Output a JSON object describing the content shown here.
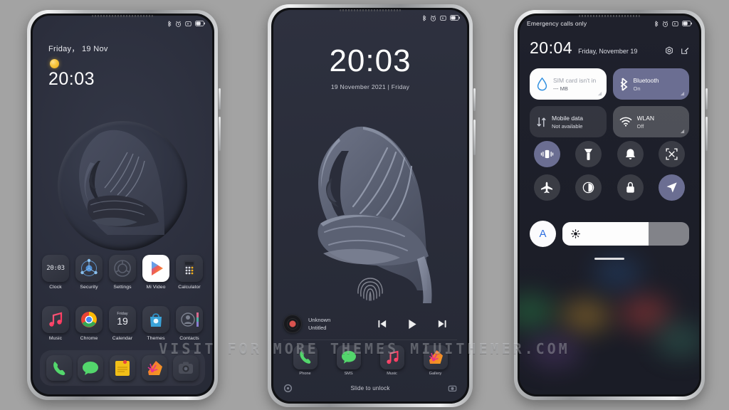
{
  "background_color": "#a3a3a3",
  "watermark": "VISIT FOR MORE THEMES MIUITHEMER.COM",
  "phone1": {
    "name": "home-screen",
    "statusbar": {
      "left_text": "",
      "icons": [
        "bluetooth-icon",
        "alarm-icon",
        "dnd-icon",
        "battery-icon"
      ]
    },
    "widget": {
      "date": "Friday， 19 Nov",
      "weather_icon": "sun-icon",
      "time": "20:03"
    },
    "wallpaper": "hijab-silhouette-emboss-circle",
    "apps_row1": [
      {
        "label": "Clock",
        "icon": "clock-icon",
        "display": "20:03"
      },
      {
        "label": "Security",
        "icon": "security-icon"
      },
      {
        "label": "Settings",
        "icon": "settings-icon"
      },
      {
        "label": "Mi Video",
        "icon": "mi-video-icon"
      },
      {
        "label": "Calculator",
        "icon": "calculator-icon"
      }
    ],
    "apps_row2": [
      {
        "label": "Music",
        "icon": "music-icon"
      },
      {
        "label": "Chrome",
        "icon": "chrome-icon"
      },
      {
        "label": "Calendar",
        "icon": "calendar-icon",
        "day_name": "Friday",
        "day_num": "19"
      },
      {
        "label": "Themes",
        "icon": "themes-icon"
      },
      {
        "label": "Contacts",
        "icon": "contacts-icon"
      }
    ],
    "dock": [
      {
        "label": "Phone",
        "icon": "phone-icon"
      },
      {
        "label": "Messages",
        "icon": "sms-icon"
      },
      {
        "label": "Notes",
        "icon": "notes-icon"
      },
      {
        "label": "Gallery",
        "icon": "gallery-icon"
      },
      {
        "label": "Camera",
        "icon": "camera-icon"
      }
    ]
  },
  "phone2": {
    "name": "lock-screen",
    "statusbar": {
      "left_text": "",
      "icons": [
        "bluetooth-icon",
        "alarm-icon",
        "dnd-icon",
        "battery-icon"
      ]
    },
    "time": "20:03",
    "date": "19 November 2021 | Friday",
    "wallpaper": "hijab-silhouette-emboss",
    "fingerprint_icon": "fingerprint-icon",
    "player": {
      "album_icon": "vinyl-record-icon",
      "title": "Unknown",
      "subtitle": "Untitled",
      "prev_icon": "skip-previous-icon",
      "play_icon": "play-icon",
      "next_icon": "skip-next-icon"
    },
    "shortcuts": [
      {
        "label": "Phone",
        "icon": "phone-icon"
      },
      {
        "label": "SMS",
        "icon": "sms-icon"
      },
      {
        "label": "Music",
        "icon": "music-icon"
      },
      {
        "label": "Gallery",
        "icon": "gallery-icon"
      }
    ],
    "unlock_hint": "Slide to unlock",
    "left_icon": "settings-gear-icon",
    "right_icon": "camera-icon"
  },
  "phone3": {
    "name": "control-center",
    "statusbar": {
      "left_text": "Emergency calls only",
      "icons": [
        "bluetooth-icon",
        "alarm-icon",
        "dnd-icon",
        "battery-icon"
      ]
    },
    "time": "20:04",
    "date": "Friday, November 19",
    "settings_icon": "settings-hex-icon",
    "edit_icon": "edit-icon",
    "tiles": [
      {
        "title": "SIM card isn't in",
        "subtitle": "--- MB",
        "icon": "data-drop-icon",
        "state": "on-white"
      },
      {
        "title": "Bluetooth",
        "subtitle": "On",
        "icon": "bluetooth-icon",
        "state": "on-purple"
      },
      {
        "title": "Mobile data",
        "subtitle": "Not available",
        "icon": "mobile-data-icon",
        "state": "off"
      },
      {
        "title": "WLAN",
        "subtitle": "Off",
        "icon": "wifi-icon",
        "state": "grey"
      }
    ],
    "toggles": [
      {
        "name": "vibrate-icon",
        "on": true
      },
      {
        "name": "flashlight-icon",
        "on": false
      },
      {
        "name": "ringer-bell-icon",
        "on": false
      },
      {
        "name": "screenshot-icon",
        "on": false
      },
      {
        "name": "airplane-mode-icon",
        "on": false
      },
      {
        "name": "dark-mode-icon",
        "on": false
      },
      {
        "name": "rotation-lock-icon",
        "on": false
      },
      {
        "name": "location-icon",
        "on": true
      }
    ],
    "brightness": {
      "auto_label": "A",
      "icon": "brightness-sun-icon",
      "percent": 68
    }
  }
}
